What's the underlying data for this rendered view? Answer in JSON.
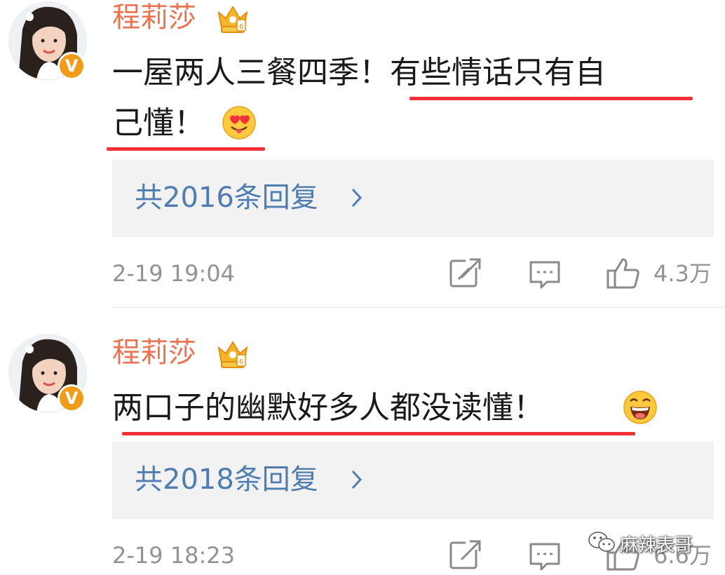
{
  "comments": [
    {
      "username": "程莉莎",
      "text_line1": "一屋两人三餐四季！有些情话只有自",
      "text_line2": "己懂！",
      "replies_label": "共2016条回复",
      "timestamp": "2-19 19:04",
      "like_count": "4.3万",
      "emoji": "heart-eyes-tongue-emoji"
    },
    {
      "username": "程莉莎",
      "text_line1": "两口子的幽默好多人都没读懂！",
      "replies_label": "共2018条回复",
      "timestamp": "2-19 18:23",
      "like_count": "6.6万",
      "emoji": "laughing-emoji"
    }
  ],
  "badges": {
    "verified": "V"
  },
  "watermark": {
    "text": "麻辣表哥",
    "icon": "wechat-icon"
  },
  "colors": {
    "username": "#eb7350",
    "link": "#507daf",
    "underline": "#f2303a",
    "meta": "#939393",
    "reply_bg": "#f2f2f2",
    "verified_badge": "#f19b1a"
  }
}
